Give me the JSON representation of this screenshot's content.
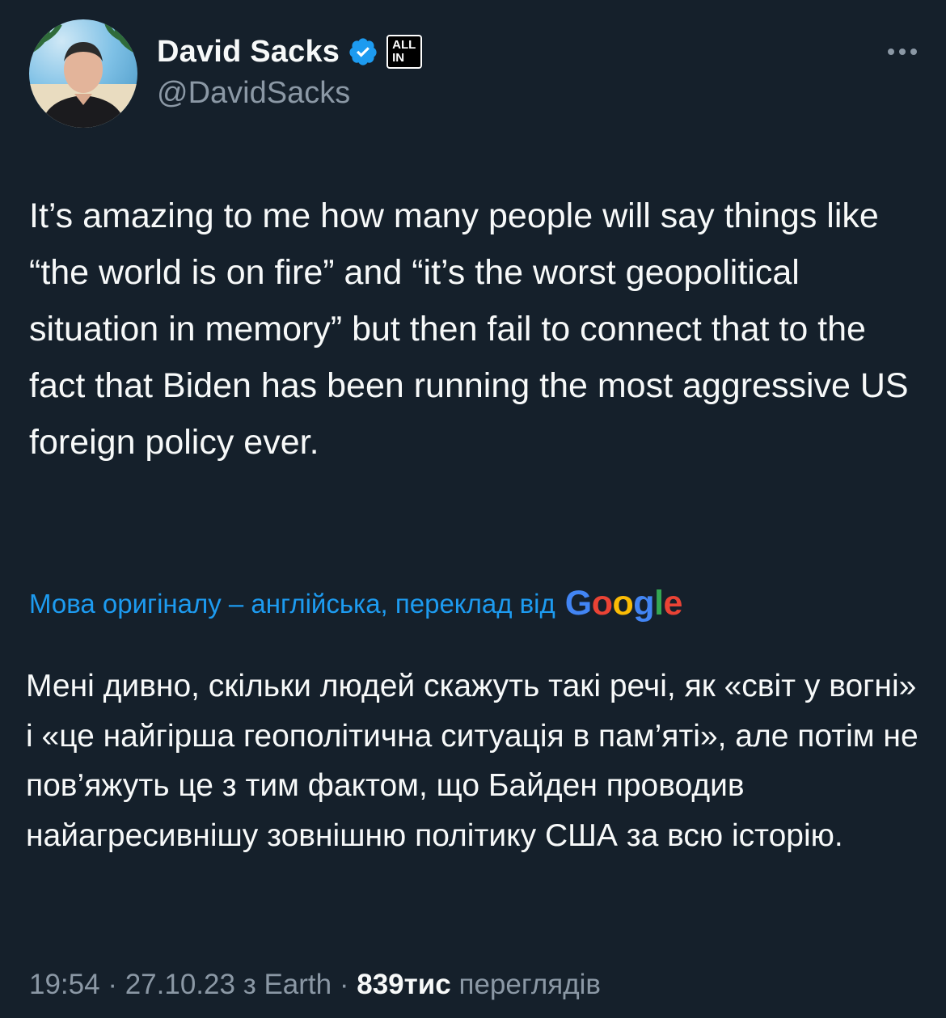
{
  "author": {
    "name": "David Sacks",
    "handle": "@DavidSacks",
    "affiliate_badge": [
      "ALL",
      "IN"
    ]
  },
  "icons": {
    "avatar": "profile-photo",
    "verified": "verified-badge-icon",
    "more": "more-options-icon"
  },
  "tweet": {
    "text": "It’s amazing to me how many people will say things like “the world is on fire” and “it’s the worst geopolitical situation in memory” but then fail to connect that to the fact that Biden has been running the most aggressive US foreign policy ever."
  },
  "translation": {
    "label": "Мова оригіналу – англійська, переклад від",
    "provider": [
      "G",
      "o",
      "o",
      "g",
      "l",
      "e"
    ],
    "text": "Мені дивно, скільки людей скажуть такі речі, як «світ у вогні» і «це найгірша геополітична ситуація в пам’яті», але потім не пов’яжуть це з тим фактом, що Байден проводив найагресивнішу зовнішню політику США за всю історію."
  },
  "meta": {
    "time": "19:54",
    "separator": " · ",
    "date": "27.10.23",
    "source": "з Earth",
    "views_count": "839тис",
    "views_label": " переглядів"
  },
  "colors": {
    "background": "#15202b",
    "text": "#f7f9f9",
    "secondary": "#8b98a5",
    "link": "#1d9bf0",
    "verified": "#1d9bf0",
    "google_blue": "#4285f4",
    "google_red": "#ea4335",
    "google_yellow": "#fbbc05",
    "google_green": "#34a853"
  }
}
